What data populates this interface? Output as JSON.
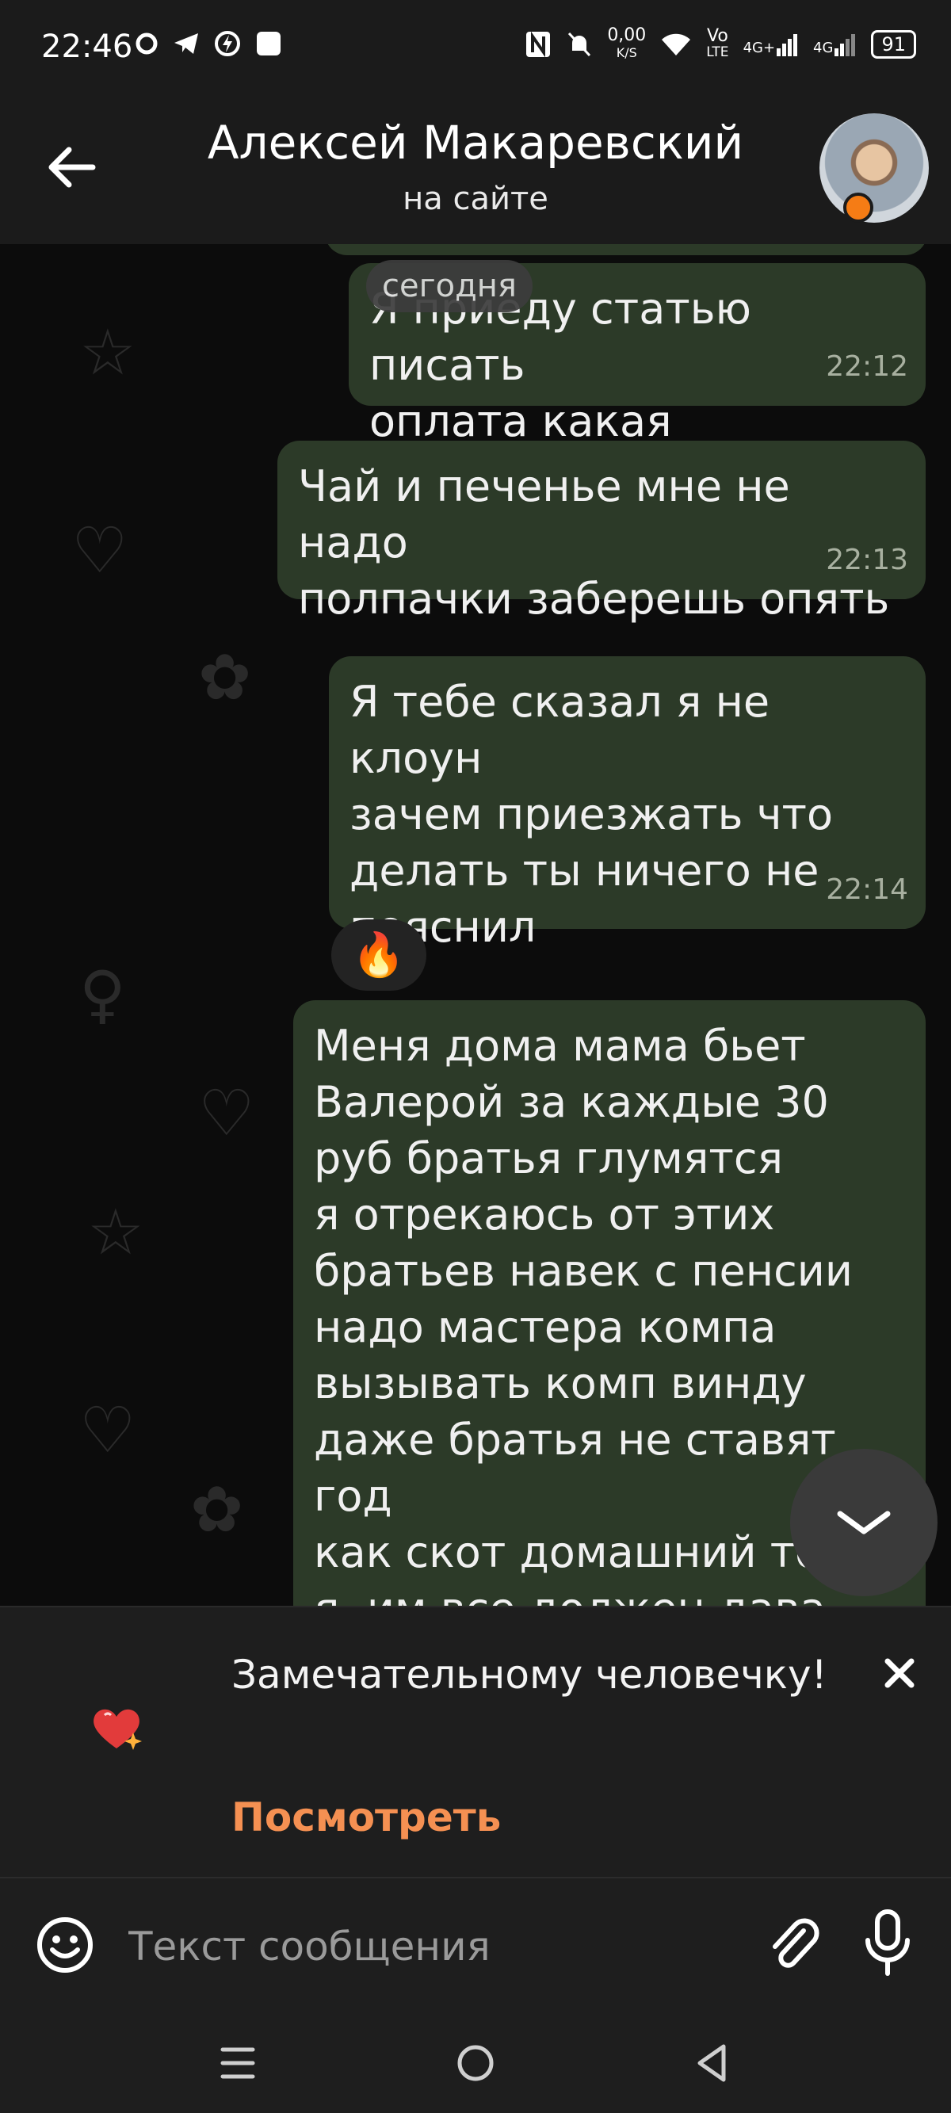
{
  "status_bar": {
    "time": "22:46",
    "net_speed_top": "0,00",
    "net_speed_bottom": "K/S",
    "volte_top": "Vo",
    "volte_bottom": "LTE",
    "signal1": "4G+",
    "signal2": "4G",
    "battery": "91"
  },
  "header": {
    "contact_name": "Алексей Макаревский",
    "status": "на сайте",
    "presence_color": "#f57c15"
  },
  "chat": {
    "date_chip": "сегодня",
    "messages": [
      {
        "text": "Я приеду статью писать\nоплата какая",
        "time": "22:12"
      },
      {
        "text": "Чай и печенье мне не надо\nполпачки заберешь опять",
        "time": "22:13"
      },
      {
        "text": "Я тебе сказал я не клоун\nзачем приезжать что\nделать ты ничего не\nпояснил",
        "time": "22:14",
        "reaction": "🔥"
      },
      {
        "text": "Меня дома мама бьет\nВалерой за каждые 30\nруб братья глумятся\nя отрекаюсь от этих\nбратьев навек с пенсии\nнадо мастера компа\nвызывать комп винду\nдаже братья не ставят год\nкак скот домашний то\nя, им все должен дава\nони мастера требовать"
      }
    ],
    "bubble_color": "#2c3a28"
  },
  "promo": {
    "text": "Замечательному человечку!",
    "link_label": "Посмотреть",
    "link_color": "#f59052",
    "icon": "heart-sparkle-icon"
  },
  "input": {
    "placeholder": "Текст сообщения"
  },
  "nav": {
    "icons": [
      "menu-icon",
      "home-icon",
      "back-triangle-icon"
    ]
  }
}
